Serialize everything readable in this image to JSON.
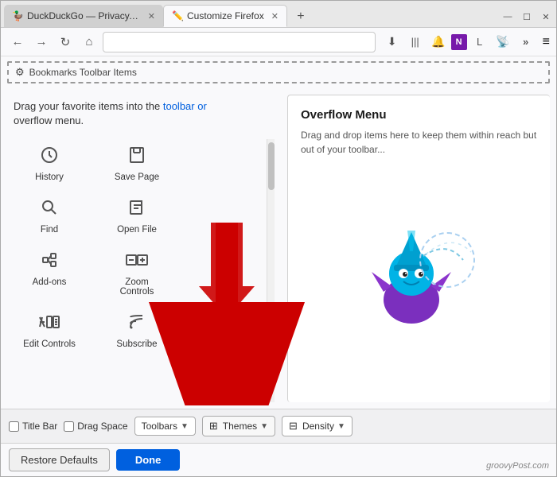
{
  "window": {
    "tabs": [
      {
        "id": "ddg",
        "title": "DuckDuckGo — Privacy, sin",
        "favicon": "🦆",
        "active": false
      },
      {
        "id": "customize",
        "title": "Customize Firefox",
        "favicon": "✏️",
        "active": true
      }
    ],
    "new_tab_icon": "+",
    "controls": {
      "minimize": "—",
      "maximize": "☐",
      "close": "✕"
    }
  },
  "toolbar": {
    "back": "←",
    "forward": "→",
    "reload": "↻",
    "home": "⌂",
    "address_text": "",
    "address_placeholder": "",
    "download_icon": "⬇",
    "bookmarks_icon": "📚",
    "bell_icon": "🔔",
    "onenote_icon": "N",
    "person_icon": "L",
    "rss_icon": "📡",
    "overflow": "»",
    "hamburger": "≡"
  },
  "bookmarks_bar": {
    "label": "Bookmarks Toolbar Items"
  },
  "main": {
    "intro_line1": "Drag your favorite items into the toolbar or",
    "intro_line2": "overflow menu.",
    "intro_highlight": "toolbar or"
  },
  "items": [
    {
      "id": "history",
      "label": "History",
      "icon": "🕐"
    },
    {
      "id": "save-page",
      "label": "Save Page",
      "icon": "📄"
    },
    {
      "id": "find",
      "label": "Find",
      "icon": "🔍"
    },
    {
      "id": "open-file",
      "label": "Open File",
      "icon": "📂"
    },
    {
      "id": "add-ons",
      "label": "Add-ons",
      "icon": "🧩"
    },
    {
      "id": "zoom-controls",
      "label": "Zoom Controls",
      "icon": "⊟+"
    },
    {
      "id": "edit-controls",
      "label": "Edit Controls",
      "icon": "✂📋"
    },
    {
      "id": "subscribe",
      "label": "Subscribe",
      "icon": "📶"
    }
  ],
  "overflow_menu": {
    "title": "Overflow Menu",
    "description": "Drag and drop items here to keep them within reach but out of your toolbar..."
  },
  "bottom_bar": {
    "title_bar_label": "Title Bar",
    "drag_space_label": "Drag Space",
    "toolbars_label": "Toolbars",
    "themes_label": "Themes",
    "density_label": "Density"
  },
  "action_bar": {
    "restore_label": "Restore Defaults",
    "done_label": "Done"
  },
  "watermark": "groovyPost.com"
}
